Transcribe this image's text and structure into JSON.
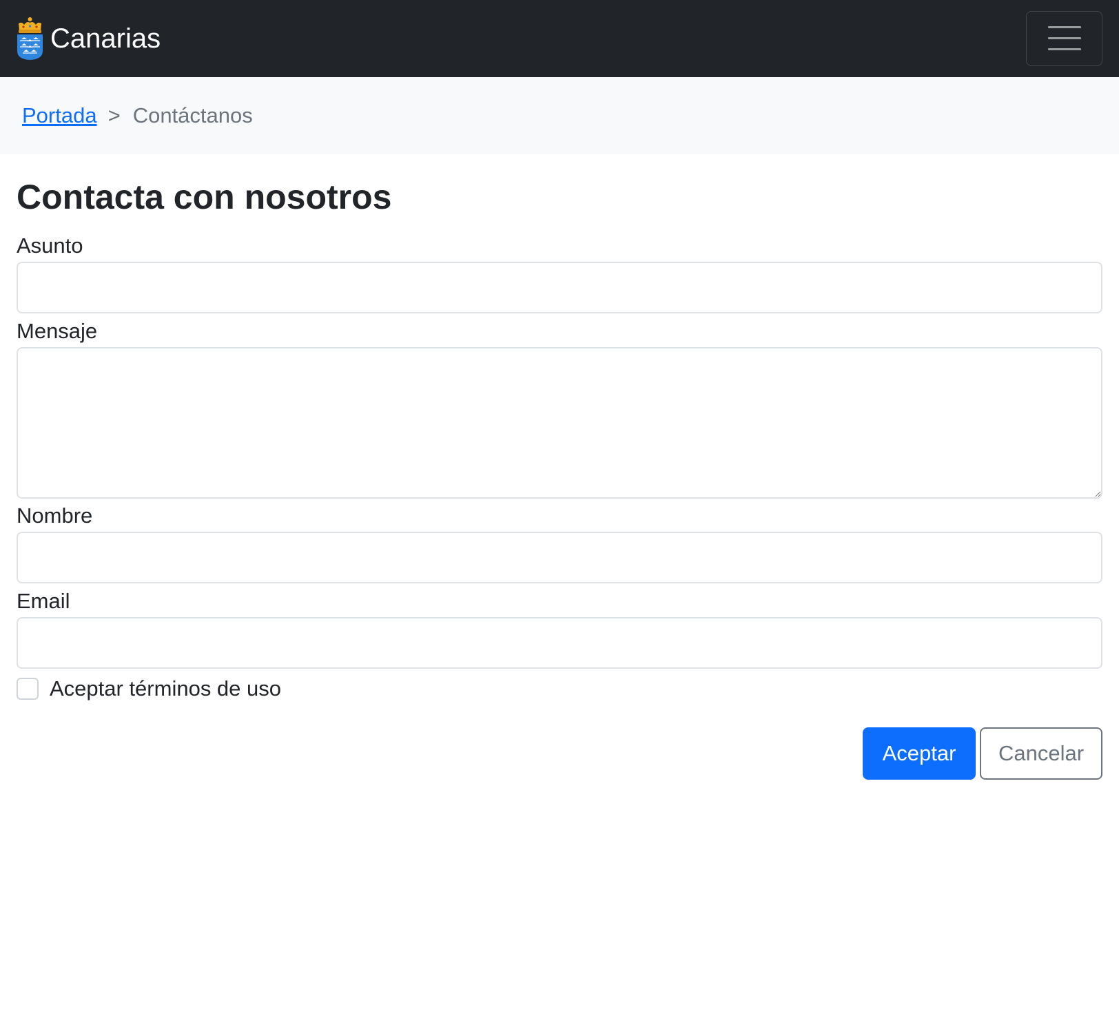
{
  "navbar": {
    "brand_text": "Canarias",
    "logo_icon": "canarias-coat-of-arms-icon",
    "toggler_icon": "hamburger-menu-icon"
  },
  "breadcrumb": {
    "home_label": "Portada",
    "separator": ">",
    "current_label": "Contáctanos"
  },
  "form": {
    "title": "Contacta con nosotros",
    "subject_label": "Asunto",
    "subject_value": "",
    "message_label": "Mensaje",
    "message_value": "",
    "name_label": "Nombre",
    "name_value": "",
    "email_label": "Email",
    "email_value": "",
    "terms_label": "Aceptar términos de uso",
    "terms_checked": false,
    "submit_label": "Aceptar",
    "cancel_label": "Cancelar"
  },
  "colors": {
    "navbar_bg": "#212529",
    "breadcrumb_bg": "#f8f9fa",
    "primary": "#0d6efd",
    "secondary": "#6c757d"
  }
}
